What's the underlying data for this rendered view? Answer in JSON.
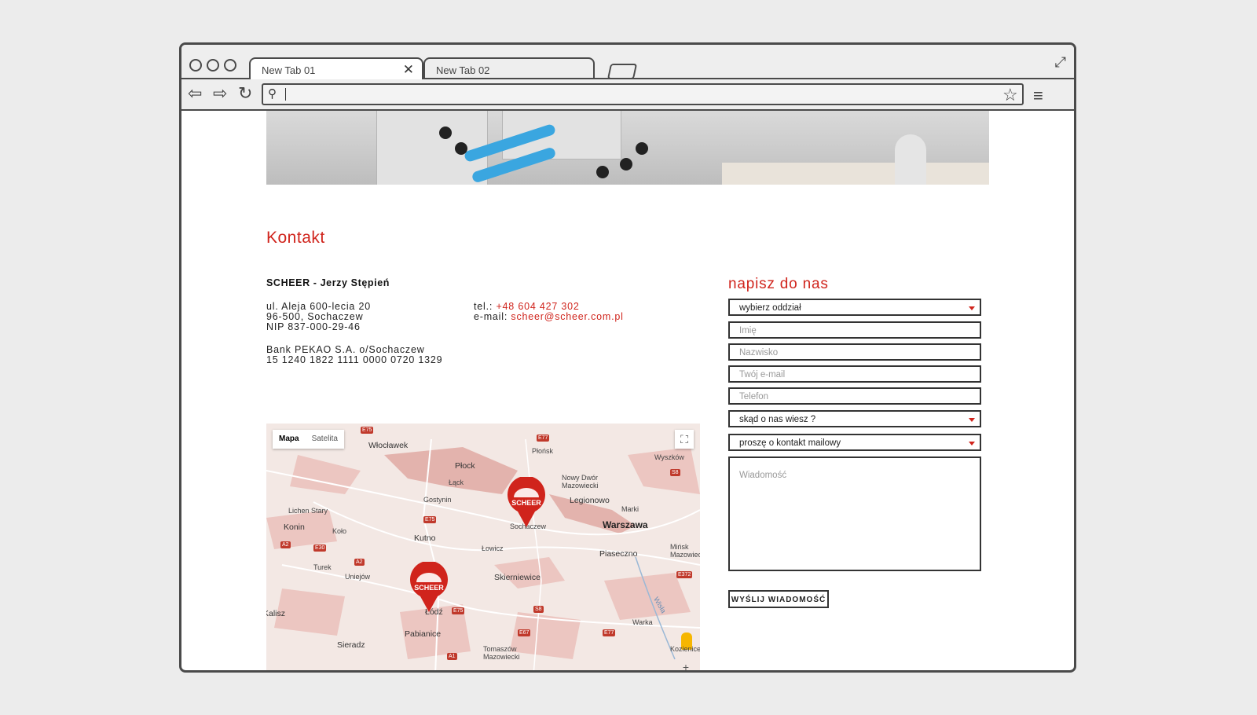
{
  "browser": {
    "tabs": [
      {
        "label": "New Tab 01",
        "close_label": "✕"
      },
      {
        "label": "New Tab 02"
      }
    ],
    "address_value": ""
  },
  "page": {
    "title": "Kontakt",
    "company": "SCHEER - Jerzy Stępień",
    "address_lines": [
      "ul. Aleja 600-lecia 20",
      "96-500, Sochaczew",
      "NIP 837-000-29-46"
    ],
    "bank_lines": [
      "Bank PEKAO S.A. o/Sochaczew",
      "15 1240 1822 1111 0000 0720 1329"
    ],
    "phone_label": "tel.:",
    "phone": "+48 604 427 302",
    "email_label": "e-mail:",
    "email": "scheer@scheer.com.pl"
  },
  "form": {
    "title": "napisz do nas",
    "branch_select": "wybierz oddział",
    "name_placeholder": "Imię",
    "surname_placeholder": "Nazwisko",
    "email_placeholder": "Twój e-mail",
    "phone_placeholder": "Telefon",
    "source_select": "skąd o nas wiesz ?",
    "contact_select": "proszę o kontakt mailowy",
    "message_placeholder": "Wiadomość",
    "submit_label": "WYŚLIJ WIADOMOŚĆ"
  },
  "map": {
    "toggle_map": "Mapa",
    "toggle_satellite": "Satelita",
    "marker_text": "SCHEER",
    "cities": [
      {
        "name": "Włocławek"
      },
      {
        "name": "Płock"
      },
      {
        "name": "Płońsk"
      },
      {
        "name": "Wyszków"
      },
      {
        "name": "Nowy Dwór Mazowiecki"
      },
      {
        "name": "Legionowo"
      },
      {
        "name": "Marki"
      },
      {
        "name": "Warszawa"
      },
      {
        "name": "Sochaczew"
      },
      {
        "name": "Gostynin"
      },
      {
        "name": "Łąck"
      },
      {
        "name": "Lichen Stary"
      },
      {
        "name": "Konin"
      },
      {
        "name": "Koło"
      },
      {
        "name": "Kutno"
      },
      {
        "name": "Łowicz"
      },
      {
        "name": "Piaseczno"
      },
      {
        "name": "Mińsk Mazowiecki"
      },
      {
        "name": "Turek"
      },
      {
        "name": "Uniejów"
      },
      {
        "name": "Skierniewice"
      },
      {
        "name": "Kalisz"
      },
      {
        "name": "Łódź"
      },
      {
        "name": "Pabianice"
      },
      {
        "name": "Warka"
      },
      {
        "name": "Sieradz"
      },
      {
        "name": "Tomaszów Mazowiecki"
      },
      {
        "name": "Kozienice"
      },
      {
        "name": "Wisła"
      }
    ],
    "roads": [
      "E75",
      "E77",
      "S8",
      "E75",
      "E30",
      "A2",
      "A2",
      "E372",
      "E75",
      "S8",
      "E67",
      "E77",
      "A1"
    ]
  },
  "colors": {
    "accent": "#d0241c",
    "frame": "#4a4a4a",
    "background": "#ececec"
  }
}
